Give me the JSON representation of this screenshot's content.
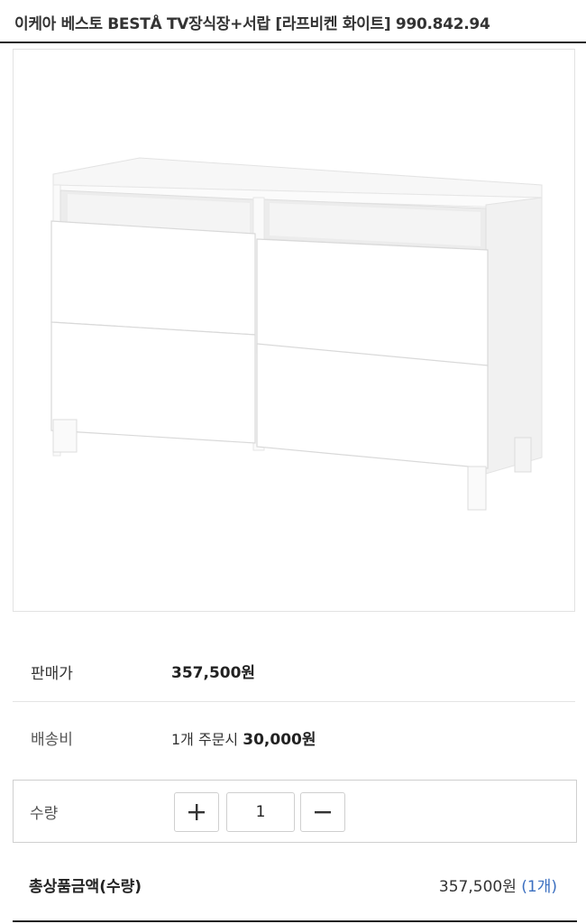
{
  "product": {
    "title": "이케아 베스토 BESTÅ TV장식장+서랍 [라프비켄 화이트] 990.842.94"
  },
  "price": {
    "label": "판매가",
    "value": "357,500원"
  },
  "shipping": {
    "label": "배송비",
    "prefix": "1개 주문시",
    "amount": "30,000원"
  },
  "quantity": {
    "label": "수량",
    "value": "1",
    "plus_icon": "plus-icon",
    "minus_icon": "minus-icon"
  },
  "total": {
    "label": "총상품금액(수량)",
    "amount": "357,500원",
    "count": "(1개)"
  },
  "colors": {
    "accent_blue": "#3b6fc0",
    "border": "#cfcfcf",
    "divider": "#e4e4e4"
  }
}
